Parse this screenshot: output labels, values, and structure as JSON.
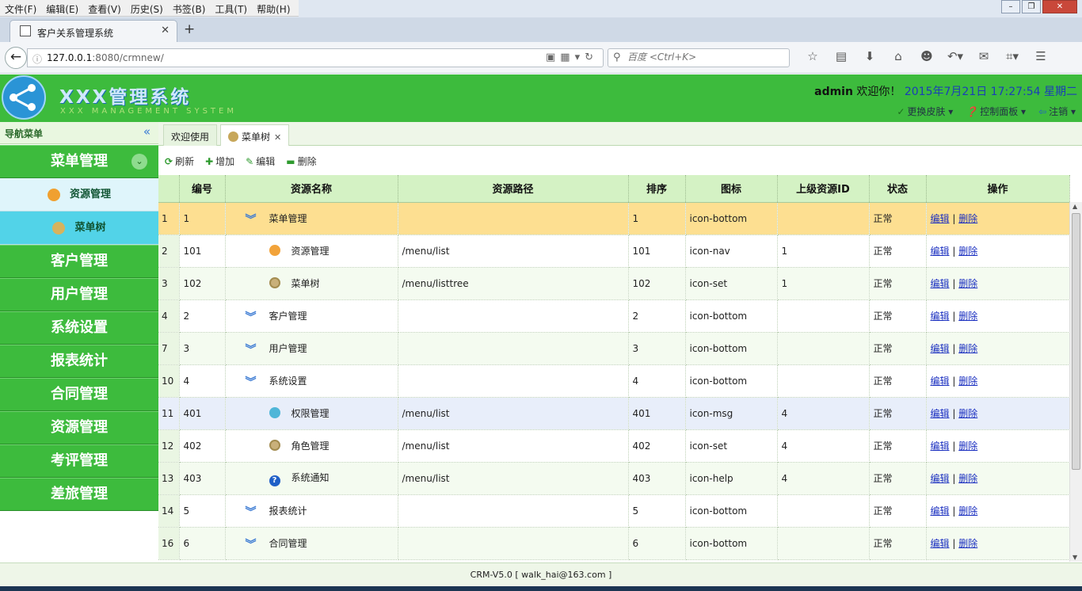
{
  "browser": {
    "menus": [
      "文件(F)",
      "编辑(E)",
      "查看(V)",
      "历史(S)",
      "书签(B)",
      "工具(T)",
      "帮助(H)"
    ],
    "tab_title": "客户关系管理系统",
    "url_host": "127.0.0.1",
    "url_rest": ":8080/crmnew/",
    "search_placeholder": "百度 <Ctrl+K>"
  },
  "header": {
    "title": "XXX管理系统",
    "subtitle": "XXX MANAGEMENT SYSTEM",
    "user": "admin",
    "greeting": "欢迎你！",
    "datetime": "2015年7月21日 17:27:54 星期二",
    "links": [
      "更换皮肤",
      "控制面板",
      "注销"
    ]
  },
  "sidebar": {
    "title": "导航菜单",
    "groups": [
      "菜单管理",
      "客户管理",
      "用户管理",
      "系统设置",
      "报表统计",
      "合同管理",
      "资源管理",
      "考评管理",
      "差旅管理"
    ],
    "subitems": [
      "资源管理",
      "菜单树"
    ]
  },
  "tabs": [
    "欢迎使用",
    "菜单树"
  ],
  "toolbar": [
    "刷新",
    "增加",
    "编辑",
    "删除"
  ],
  "grid": {
    "columns": [
      "编号",
      "资源名称",
      "资源路径",
      "排序",
      "图标",
      "上级资源ID",
      "状态",
      "操作"
    ],
    "rows": [
      {
        "rn": "1",
        "id": "1",
        "name": "菜单管理",
        "path": "",
        "sort": "1",
        "icon": "icon-bottom",
        "parent": "",
        "status": "正常",
        "level": 0
      },
      {
        "rn": "2",
        "id": "101",
        "name": "资源管理",
        "path": "/menu/list",
        "sort": "101",
        "icon": "icon-nav",
        "parent": "1",
        "status": "正常",
        "level": 1
      },
      {
        "rn": "3",
        "id": "102",
        "name": "菜单树",
        "path": "/menu/listtree",
        "sort": "102",
        "icon": "icon-set",
        "parent": "1",
        "status": "正常",
        "level": 1
      },
      {
        "rn": "4",
        "id": "2",
        "name": "客户管理",
        "path": "",
        "sort": "2",
        "icon": "icon-bottom",
        "parent": "",
        "status": "正常",
        "level": 0
      },
      {
        "rn": "7",
        "id": "3",
        "name": "用户管理",
        "path": "",
        "sort": "3",
        "icon": "icon-bottom",
        "parent": "",
        "status": "正常",
        "level": 0
      },
      {
        "rn": "10",
        "id": "4",
        "name": "系统设置",
        "path": "",
        "sort": "4",
        "icon": "icon-bottom",
        "parent": "",
        "status": "正常",
        "level": 0
      },
      {
        "rn": "11",
        "id": "401",
        "name": "权限管理",
        "path": "/menu/list",
        "sort": "401",
        "icon": "icon-msg",
        "parent": "4",
        "status": "正常",
        "level": 1
      },
      {
        "rn": "12",
        "id": "402",
        "name": "角色管理",
        "path": "/menu/list",
        "sort": "402",
        "icon": "icon-set",
        "parent": "4",
        "status": "正常",
        "level": 1
      },
      {
        "rn": "13",
        "id": "403",
        "name": "系统通知",
        "path": "/menu/list",
        "sort": "403",
        "icon": "icon-help",
        "parent": "4",
        "status": "正常",
        "level": 1
      },
      {
        "rn": "14",
        "id": "5",
        "name": "报表统计",
        "path": "",
        "sort": "5",
        "icon": "icon-bottom",
        "parent": "",
        "status": "正常",
        "level": 0
      },
      {
        "rn": "16",
        "id": "6",
        "name": "合同管理",
        "path": "",
        "sort": "6",
        "icon": "icon-bottom",
        "parent": "",
        "status": "正常",
        "level": 0
      }
    ],
    "action_edit": "编辑",
    "action_delete": "删除",
    "action_sep": "|"
  },
  "footer": "CRM-V5.0 [ walk_hai@163.com ]"
}
